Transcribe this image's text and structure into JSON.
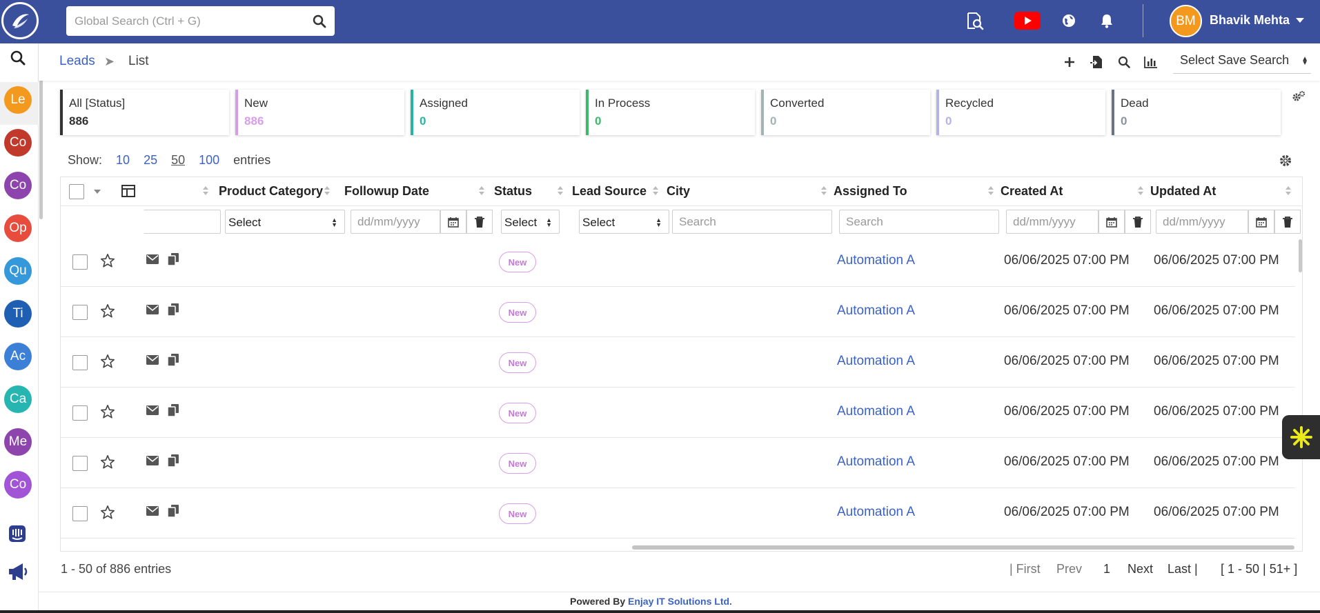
{
  "header": {
    "search_placeholder": "Global Search (Ctrl + G)",
    "user_initials": "BM",
    "user_name": "Bhavik Mehta"
  },
  "sidebar": {
    "modules": [
      {
        "abbr": "Le",
        "color": "#f39a1e"
      },
      {
        "abbr": "Co",
        "color": "#c0392b"
      },
      {
        "abbr": "Co",
        "color": "#8e44ad"
      },
      {
        "abbr": "Op",
        "color": "#e74c3c"
      },
      {
        "abbr": "Qu",
        "color": "#3498db"
      },
      {
        "abbr": "Ti",
        "color": "#1e5fb3"
      },
      {
        "abbr": "Ac",
        "color": "#3b7fd6"
      },
      {
        "abbr": "Ca",
        "color": "#26b5b0"
      },
      {
        "abbr": "Me",
        "color": "#8e44ad"
      },
      {
        "abbr": "Co",
        "color": "#a155d6"
      }
    ]
  },
  "breadcrumb": {
    "root": "Leads",
    "separator": "➤",
    "current": "List"
  },
  "save_search": {
    "label": "Select Save Search"
  },
  "status_cards": [
    {
      "label": "All [Status]",
      "count": "886",
      "border": "#333333",
      "count_color": "#333333"
    },
    {
      "label": "New",
      "count": "886",
      "border": "#d89de8",
      "count_color": "#d89de8"
    },
    {
      "label": "Assigned",
      "count": "0",
      "border": "#26b5a0",
      "count_color": "#26b5a0"
    },
    {
      "label": "In Process",
      "count": "0",
      "border": "#3cb96a",
      "count_color": "#3cb96a"
    },
    {
      "label": "Converted",
      "count": "0",
      "border": "#a3b3b3",
      "count_color": "#a3b3b3"
    },
    {
      "label": "Recycled",
      "count": "0",
      "border": "#b3b3e6",
      "count_color": "#b3b3e6"
    },
    {
      "label": "Dead",
      "count": "0",
      "border": "#6a7383",
      "count_color": "#8a93a3"
    }
  ],
  "show_entries": {
    "prefix": "Show:",
    "options": [
      "10",
      "25",
      "50",
      "100"
    ],
    "selected": "50",
    "suffix": "entries"
  },
  "table": {
    "columns": [
      "Product Category",
      "Followup Date",
      "Status",
      "Lead Source",
      "City",
      "Assigned To",
      "Created At",
      "Updated At"
    ],
    "filters": {
      "product_category": "Select",
      "followup_date_placeholder": "dd/mm/yyyy",
      "status": "Select",
      "lead_source": "Select",
      "city_placeholder": "Search",
      "assigned_to_placeholder": "Search",
      "created_at_placeholder": "dd/mm/yyyy",
      "updated_at_placeholder": "dd/mm/yyyy"
    },
    "rows": [
      {
        "status": "New",
        "assigned_to": "Automation A",
        "created_at": "06/06/2025 07:00 PM",
        "updated_at": "06/06/2025 07:00 PM"
      },
      {
        "status": "New",
        "assigned_to": "Automation A",
        "created_at": "06/06/2025 07:00 PM",
        "updated_at": "06/06/2025 07:00 PM"
      },
      {
        "status": "New",
        "assigned_to": "Automation A",
        "created_at": "06/06/2025 07:00 PM",
        "updated_at": "06/06/2025 07:00 PM"
      },
      {
        "status": "New",
        "assigned_to": "Automation A",
        "created_at": "06/06/2025 07:00 PM",
        "updated_at": "06/06/2025 07:00 PM"
      },
      {
        "status": "New",
        "assigned_to": "Automation A",
        "created_at": "06/06/2025 07:00 PM",
        "updated_at": "06/06/2025 07:00 PM"
      },
      {
        "status": "New",
        "assigned_to": "Automation A",
        "created_at": "06/06/2025 07:00 PM",
        "updated_at": "06/06/2025 07:00 PM"
      }
    ]
  },
  "footer": {
    "entries_info": "1 - 50 of 886 entries",
    "first": "| First",
    "prev": "Prev",
    "page": "1",
    "next": "Next",
    "last": "Last |",
    "range": "[ 1 - 50 | 51+ ]",
    "powered_prefix": "Powered By",
    "powered_company": "Enjay IT Solutions Ltd."
  }
}
